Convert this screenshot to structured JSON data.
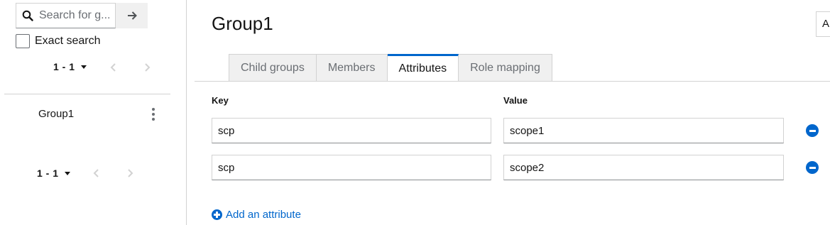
{
  "sidebar": {
    "search": {
      "placeholder": "Search for g...",
      "value": ""
    },
    "exact_search_label": "Exact search",
    "pager_top": {
      "count": "1 - 1"
    },
    "groups": [
      {
        "name": "Group1"
      }
    ],
    "pager_bottom": {
      "count": "1 - 1"
    }
  },
  "main": {
    "title": "Group1",
    "action_label": "A",
    "tabs": [
      {
        "label": "Child groups",
        "active": false
      },
      {
        "label": "Members",
        "active": false
      },
      {
        "label": "Attributes",
        "active": true
      },
      {
        "label": "Role mapping",
        "active": false
      }
    ],
    "columns": {
      "key": "Key",
      "value": "Value"
    },
    "attributes": [
      {
        "key": "scp",
        "value": "scope1"
      },
      {
        "key": "scp",
        "value": "scope2"
      }
    ],
    "add_attribute_label": "Add an attribute"
  },
  "colors": {
    "accent": "#0066cc",
    "border": "#d2d2d2",
    "muted": "#6a6e73"
  },
  "icons": [
    "search-icon",
    "arrow-right-icon",
    "caret-down-icon",
    "chevron-left-icon",
    "chevron-right-icon",
    "kebab-icon",
    "minus-circle-icon",
    "plus-circle-icon"
  ]
}
